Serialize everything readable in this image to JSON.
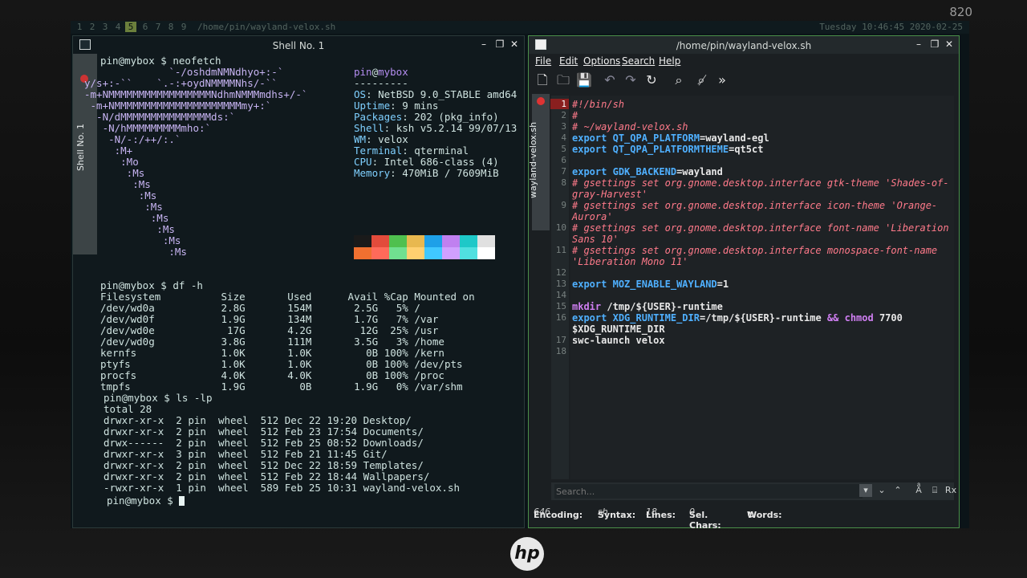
{
  "device": {
    "model": "820",
    "brand": "hp"
  },
  "topbar": {
    "workspaces": [
      "1",
      "2",
      "3",
      "4",
      "5",
      "6",
      "7",
      "8",
      "9"
    ],
    "active_workspace": "5",
    "window_title": "/home/pin/wayland-velox.sh",
    "clock": "Tuesday 10:46:45 2020-02-25"
  },
  "terminal": {
    "title": "Shell No. 1",
    "tab_label": "Shell No. 1",
    "prompt": "pin@mybox $",
    "cmd1": "neofetch",
    "art": [
      "              `-/oshdmNMNdhyo+:-`",
      "y/s+:-``    `.-:+oydNMMMMNhs/-``",
      "-m+NMMMMMMMMMMMMMMMMMNdhmNMMMmdhs+/-`",
      " -m+NMMMMMMMMMMMMMMMMMMMMMmy+:`",
      "  -N/dMMMMMMMMMMMMMMMds:`",
      "   -N/hMMMMMMMMMmho:`",
      "    -N/-:/++/:.`",
      "     :M+",
      "      :Mo",
      "       :Ms",
      "        :Ms",
      "         :Ms",
      "          :Ms",
      "           :Ms",
      "            :Ms",
      "             :Ms",
      "              :Ms"
    ],
    "info_user": "pin",
    "info_at": "@",
    "info_host": "mybox",
    "info_sep": "---------",
    "info": [
      {
        "k": "OS",
        "v": "NetBSD 9.0_STABLE amd64"
      },
      {
        "k": "Uptime",
        "v": "9 mins"
      },
      {
        "k": "Packages",
        "v": "202 (pkg_info)"
      },
      {
        "k": "Shell",
        "v": "ksh v5.2.14 99/07/13"
      },
      {
        "k": "WM",
        "v": "velox"
      },
      {
        "k": "Terminal",
        "v": "qterminal"
      },
      {
        "k": "CPU",
        "v": "Intel 686-class (4)"
      },
      {
        "k": "Memory",
        "v": "470MiB / 7609MiB"
      }
    ],
    "palette_top": [
      "#1a1a1a",
      "#e24b3b",
      "#4fc04f",
      "#e8b84f",
      "#1ea0e8",
      "#c080f0",
      "#1ec8c8",
      "#e0e0e0"
    ],
    "palette_bottom": [
      "#f07030",
      "#ff6a5a",
      "#70e090",
      "#ffd070",
      "#40c8ff",
      "#d0a0ff",
      "#50e0e0",
      "#ffffff"
    ],
    "cmd2": "df -h",
    "df_header": "Filesystem          Size       Used      Avail %Cap Mounted on",
    "df_rows": [
      "/dev/wd0a           2.8G       154M       2.5G   5% /",
      "/dev/wd0f           1.9G       134M       1.7G   7% /var",
      "/dev/wd0e            17G       4.2G        12G  25% /usr",
      "/dev/wd0g           3.8G       111M       3.5G   3% /home",
      "kernfs              1.0K       1.0K         0B 100% /kern",
      "ptyfs               1.0K       1.0K         0B 100% /dev/pts",
      "procfs              4.0K       4.0K         0B 100% /proc",
      "tmpfs               1.9G         0B       1.9G   0% /var/shm"
    ],
    "cmd3": "ls -lp",
    "ls_total": "total 28",
    "ls_rows": [
      "drwxr-xr-x  2 pin  wheel  512 Dec 22 19:20 Desktop/",
      "drwxr-xr-x  2 pin  wheel  512 Feb 23 17:54 Documents/",
      "drwx------  2 pin  wheel  512 Feb 25 08:52 Downloads/",
      "drwxr-xr-x  3 pin  wheel  512 Feb 21 11:45 Git/",
      "drwxr-xr-x  2 pin  wheel  512 Dec 22 18:59 Templates/",
      "drwxr-xr-x  2 pin  wheel  512 Feb 22 18:44 Wallpapers/",
      "-rwxr-xr-x  1 pin  wheel  589 Feb 25 10:31 wayland-velox.sh"
    ],
    "final_prompt": "pin@mybox $"
  },
  "editor": {
    "title": "/home/pin/wayland-velox.sh",
    "tab_label": "wayland-velox.sh",
    "menu": [
      "File",
      "Edit",
      "Options",
      "Search",
      "Help"
    ],
    "toolbar_icons": [
      "new-file-icon",
      "open-folder-icon",
      "save-icon",
      "undo-icon",
      "redo-icon",
      "reload-icon",
      "find-icon",
      "find-replace-icon",
      "more-icon"
    ],
    "line_numbers": [
      "1",
      "2",
      "3",
      "4",
      "5",
      "6",
      "7",
      "8",
      "9",
      "10",
      "11",
      "12",
      "13",
      "14",
      "15",
      "16",
      "17",
      "18"
    ],
    "current_line": "1",
    "code": {
      "l1": "#!/bin/sh",
      "l2": "#",
      "l3": "# ~/wayland-velox.sh",
      "l4_kw": "export",
      "l4_var": "QT_QPA_PLATFORM",
      "l4_val": "=wayland-egl",
      "l5_kw": "export",
      "l5_var": "QT_QPA_PLATFORMTHEME",
      "l5_val": "=qt5ct",
      "l7_kw": "export",
      "l7_var": "GDK_BACKEND",
      "l7_val": "=wayland",
      "l8a": "# gsettings set org.gnome.desktop.interface gtk-theme 'Shades-of-",
      "l8b": "gray-Harvest'",
      "l9a": "# gsettings set org.gnome.desktop.interface icon-theme 'Orange-",
      "l9b": "Aurora'",
      "l10a": "# gsettings set org.gnome.desktop.interface font-name 'Liberation",
      "l10b": "Sans 10'",
      "l11a": "# gsettings set org.gnome.desktop.interface monospace-font-name",
      "l11b": "'Liberation Mono 11'",
      "l13_kw": "export",
      "l13_var": "MOZ_ENABLE_WAYLAND",
      "l13_val": "=1",
      "l15_cmd": "mkdir",
      "l15_val": " /tmp/${USER}-runtime",
      "l16_kw": "export",
      "l16_var": "XDG_RUNTIME_DIR",
      "l16_val": "=/tmp/${USER}-runtime ",
      "l16_and": "&&",
      "l16_cmd": "chmod",
      "l16_num": " 7700",
      "l16b": "$XDG_RUNTIME_DIR",
      "l17": "swc-launch velox"
    },
    "search_placeholder": "Search...",
    "status": {
      "encoding_label": "Encoding:",
      "encoding_value": "646",
      "syntax_label": "Syntax:",
      "syntax_value": "sh",
      "lines_label": "Lines:",
      "lines_value": "18",
      "selchars_label": "Sel. Chars:",
      "selchars_value": "0",
      "words_label": "Words:"
    }
  }
}
